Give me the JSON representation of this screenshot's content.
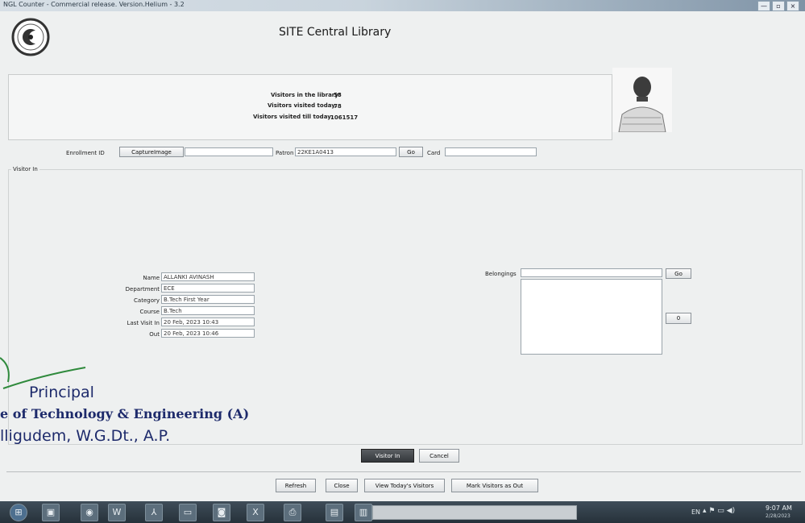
{
  "window": {
    "title": "NGL Counter - Commercial release. Version.Helium - 3.2",
    "controls": [
      "—",
      "▫",
      "×"
    ]
  },
  "header": {
    "library_name": "SITE Central Library",
    "stats": {
      "in_library_label": "Visitors in the library:",
      "in_library_value": "58",
      "visited_today_label": "Visitors visited today:",
      "visited_today_value": "78",
      "visited_till_today_label": "Visitors visited till today:",
      "visited_till_today_value": "1061517"
    }
  },
  "toolbar": {
    "enrollment_label": "Enrollment ID",
    "capture_label": "CaptureImage",
    "enrollment_value": "",
    "patron_label": "Patron Id",
    "patron_value": "22KE1A0413",
    "go_label": "Go",
    "card_label": "Card",
    "card_value": ""
  },
  "visitor": {
    "section_label": "Visitor In",
    "fields": [
      {
        "label": "Name",
        "value": "ALLANKI AVINASH"
      },
      {
        "label": "Department",
        "value": "ECE"
      },
      {
        "label": "Category",
        "value": "B.Tech First Year"
      },
      {
        "label": "Course",
        "value": "B.Tech"
      },
      {
        "label": "Last Visit In",
        "value": "20 Feb, 2023 10:43"
      },
      {
        "label": "Out",
        "value": "20 Feb, 2023 10:46"
      }
    ],
    "belongings_label": "Belongings",
    "belongings_value": "",
    "belongings_go": "Go",
    "count_value": "0"
  },
  "actions": {
    "visitor_in": "Visitor In",
    "cancel": "Cancel",
    "refresh": "Refresh",
    "close": "Close",
    "view_today": "View Today's Visitors",
    "mark_out": "Mark Visitors as Out"
  },
  "stamp": {
    "line1": "Principal",
    "line2": "e of Technology & Engineering (A)",
    "line3": "lligudem, W.G.Dt., A.P."
  },
  "taskbar": {
    "icons": [
      "start-icon",
      "media-icon",
      "chrome-icon",
      "word-icon",
      "pdf-icon",
      "folder-icon",
      "camera-icon",
      "excel-icon",
      "printer-icon",
      "app-icon",
      "app2-icon"
    ],
    "lang": "EN",
    "time": "9:07 AM",
    "date": "2/28/2023"
  },
  "colors": {
    "title_accent": "#7f93a6",
    "stamp_ink": "#1d2a6b",
    "stamp_green": "#2f8a3c"
  }
}
